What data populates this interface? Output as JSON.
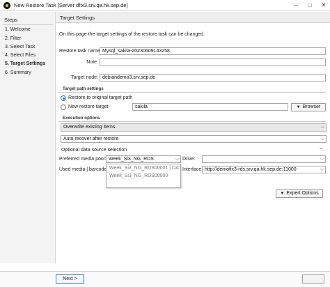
{
  "window": {
    "title": "New Restore Task [Server dfix3.srv.qa.hk.sep.de]",
    "minimize": "–",
    "maximize": "□",
    "close": "✕"
  },
  "sidebar": {
    "heading": "Steps",
    "items": [
      {
        "label": "1. Welcome"
      },
      {
        "label": "2. Filter"
      },
      {
        "label": "3. Select Task"
      },
      {
        "label": "4. Select Files"
      },
      {
        "label": "5. Target Settings"
      },
      {
        "label": "6. Summary"
      }
    ],
    "active_index": 4
  },
  "main": {
    "header": "Target Settings",
    "description": "On this page the target settings of the restore task can be changed.",
    "task_name": {
      "label": "Restore task name:",
      "value": "Mysql_sakila-20230609143258"
    },
    "note": {
      "label": "Note:",
      "value": ""
    },
    "target_node": {
      "label": "Target node:",
      "value": "debiandemo3.srv.sep.de"
    },
    "target_path": {
      "heading": "Target path settings",
      "restore_original": "Restore to original target path",
      "new_target": "New restore target",
      "new_target_value": "sakila",
      "browse": "Browser"
    },
    "execution": {
      "heading": "Execution options",
      "overwrite": "Overwrite existing items",
      "recover": "Auto recover after restore"
    },
    "optional": {
      "heading": "Optional data source selection",
      "media_pool_label": "Preferred media pool:",
      "media_pool_value": "Week_Si3_NG_RDS",
      "drive_label": "Drive:",
      "drive_value": "",
      "used_media_label": "Used media | barcode:",
      "used_media_value": "Week_Si3_NG_RDS00001 | DATA_",
      "used_media_dim": "Week_Si3_NG_RDS00000",
      "interface_label": "Interface:",
      "interface_value": "http://demofix3-rds.srv.qa.hk.sep.de:11000"
    },
    "expert_options": "Expert Options"
  },
  "footer": {
    "next": "Next >"
  }
}
